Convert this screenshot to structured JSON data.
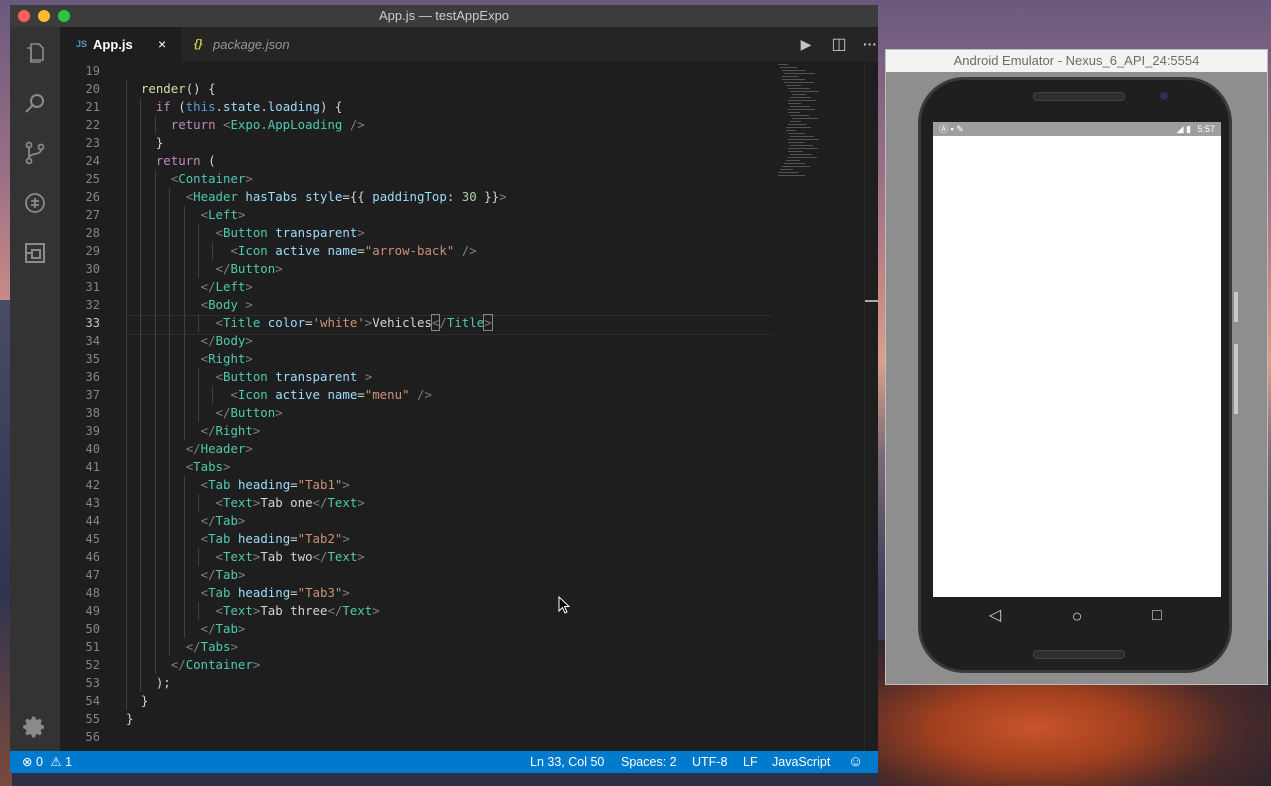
{
  "vscode": {
    "window_title": "App.js — testAppExpo",
    "tabs": [
      {
        "icon": "JS",
        "label": "App.js",
        "close": "×"
      },
      {
        "icon": "{}",
        "label": "package.json"
      }
    ],
    "actions": {
      "run": "▶",
      "split": "◫",
      "more": "···"
    },
    "code_lines": [
      {
        "n": "19",
        "indent": 0
      },
      {
        "n": "20",
        "indent": 1
      },
      {
        "n": "21",
        "indent": 2
      },
      {
        "n": "22",
        "indent": 3
      },
      {
        "n": "23",
        "indent": 2
      },
      {
        "n": "24",
        "indent": 2
      },
      {
        "n": "25",
        "indent": 3
      },
      {
        "n": "26",
        "indent": 4
      },
      {
        "n": "27",
        "indent": 5
      },
      {
        "n": "28",
        "indent": 6
      },
      {
        "n": "29",
        "indent": 7
      },
      {
        "n": "30",
        "indent": 6
      },
      {
        "n": "31",
        "indent": 5
      },
      {
        "n": "32",
        "indent": 5
      },
      {
        "n": "33",
        "indent": 6
      },
      {
        "n": "34",
        "indent": 5
      },
      {
        "n": "35",
        "indent": 5
      },
      {
        "n": "36",
        "indent": 6
      },
      {
        "n": "37",
        "indent": 7
      },
      {
        "n": "38",
        "indent": 6
      },
      {
        "n": "39",
        "indent": 5
      },
      {
        "n": "40",
        "indent": 4
      },
      {
        "n": "41",
        "indent": 4
      },
      {
        "n": "42",
        "indent": 5
      },
      {
        "n": "43",
        "indent": 6
      },
      {
        "n": "44",
        "indent": 5
      },
      {
        "n": "45",
        "indent": 5
      },
      {
        "n": "46",
        "indent": 6
      },
      {
        "n": "47",
        "indent": 5
      },
      {
        "n": "48",
        "indent": 5
      },
      {
        "n": "49",
        "indent": 6
      },
      {
        "n": "50",
        "indent": 5
      },
      {
        "n": "51",
        "indent": 4
      },
      {
        "n": "52",
        "indent": 3
      },
      {
        "n": "53",
        "indent": 2
      },
      {
        "n": "54",
        "indent": 1
      },
      {
        "n": "55",
        "indent": 0
      },
      {
        "n": "56",
        "indent": 0
      }
    ],
    "status": {
      "errors": "0",
      "warnings": "1",
      "position": "Ln 33, Col 50",
      "spaces": "Spaces: 2",
      "encoding": "UTF-8",
      "eol": "LF",
      "language": "JavaScript",
      "feedback": "☺"
    },
    "colors": {
      "statusbar": "#007acc",
      "editor_bg": "#1e1e1e",
      "activity_bg": "#333333"
    }
  },
  "emulator": {
    "title": "Android Emulator - Nexus_6_API_24:5554",
    "clock": "5:57",
    "nav": {
      "back": "◁",
      "home": "○",
      "recents": "□"
    }
  }
}
